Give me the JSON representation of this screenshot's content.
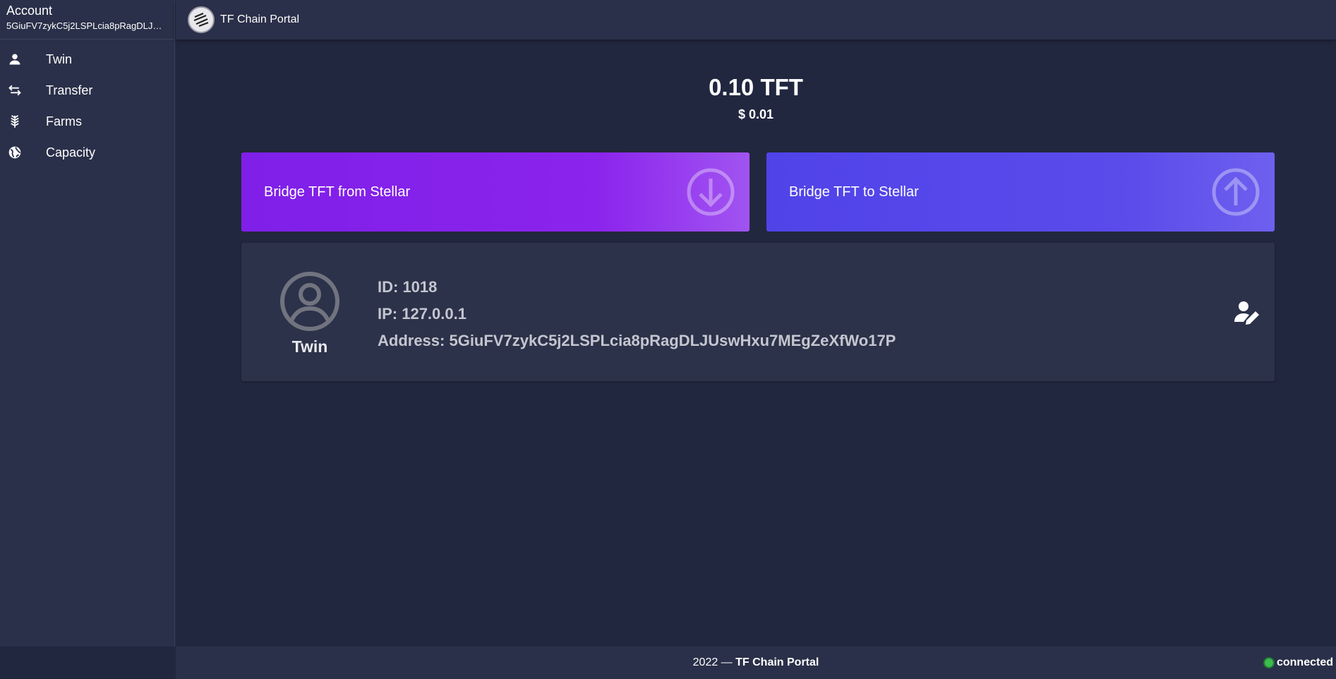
{
  "sidebar": {
    "account_title": "Account",
    "account_address": "5GiuFV7zykC5j2LSPLcia8pRagDLJUswHxu7MEgZeXfWo17P",
    "items": [
      {
        "label": "Twin",
        "icon": "person-icon"
      },
      {
        "label": "Transfer",
        "icon": "swap-arrows-icon"
      },
      {
        "label": "Farms",
        "icon": "wheat-icon"
      },
      {
        "label": "Capacity",
        "icon": "globe-icon"
      }
    ]
  },
  "header": {
    "title": "TF Chain Portal",
    "logo": "threefold-logo"
  },
  "balance": {
    "tft": "0.10 TFT",
    "usd": "$ 0.01"
  },
  "bridge": {
    "from_label": "Bridge TFT from Stellar",
    "to_label": "Bridge TFT to Stellar"
  },
  "twin": {
    "name": "Twin",
    "id_line": "ID: 1018",
    "ip_line": "IP: 127.0.0.1",
    "address_line": "Address: 5GiuFV7zykC5j2LSPLcia8pRagDLJUswHxu7MEgZeXfWo17P"
  },
  "footer": {
    "year_prefix": "2022 — ",
    "brand": "TF Chain Portal",
    "status": "connected"
  },
  "colors": {
    "background": "#222740",
    "panel": "#2a3049",
    "bridge_from": "#8b24ec",
    "bridge_to": "#5a4beb",
    "status_connected": "#3fb950"
  }
}
